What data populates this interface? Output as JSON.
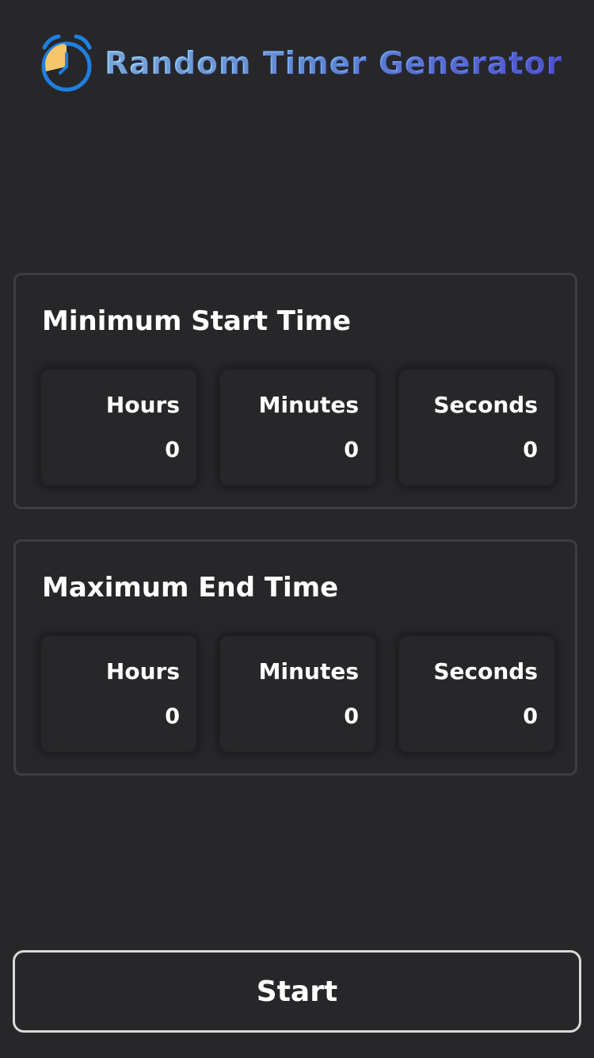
{
  "app": {
    "title": "Random Timer Generator",
    "logo_icon": "alarm-clock-icon"
  },
  "colors": {
    "background": "#27272a",
    "card_border": "#3e3e42",
    "title_gradient_start": "#93d0f7",
    "title_gradient_end": "#5a5fe6",
    "logo_blue": "#1f7fe0",
    "logo_yellow": "#f6c76a",
    "button_border": "#d9d9d9"
  },
  "min_section": {
    "title": "Minimum Start Time",
    "hours_label": "Hours",
    "hours_value": "0",
    "minutes_label": "Minutes",
    "minutes_value": "0",
    "seconds_label": "Seconds",
    "seconds_value": "0"
  },
  "max_section": {
    "title": "Maximum End Time",
    "hours_label": "Hours",
    "hours_value": "0",
    "minutes_label": "Minutes",
    "minutes_value": "0",
    "seconds_label": "Seconds",
    "seconds_value": "0"
  },
  "start_button": {
    "label": "Start"
  }
}
